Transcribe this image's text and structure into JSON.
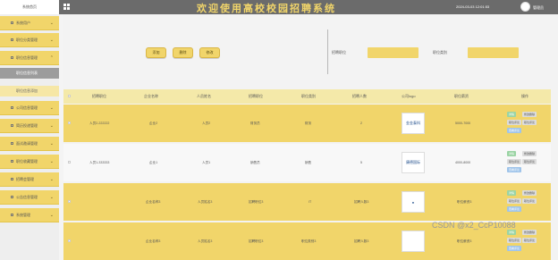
{
  "topbar": {
    "logo_text": "系统首页",
    "title": "欢迎使用高校校园招聘系统",
    "datetime": "2024-03-03 12:01:53",
    "username": "管理员"
  },
  "sidebar": {
    "items": [
      {
        "label": "系统用户"
      },
      {
        "label": "职位分类管理"
      },
      {
        "label": "职位信息管理"
      },
      {
        "label": "公司信息管理"
      },
      {
        "label": "简历投递管理"
      },
      {
        "label": "面试邀请管理"
      },
      {
        "label": "职位收藏管理"
      },
      {
        "label": "招聘会管理"
      },
      {
        "label": "公告信息管理"
      },
      {
        "label": "系统管理"
      }
    ],
    "sub_active": "职位信息列表",
    "sub_light": "职位信息添加"
  },
  "toolbar": {
    "add": "添加",
    "delete": "删除",
    "edit": "修改"
  },
  "filters": {
    "job_title_label": "招聘职位",
    "job_category_label": "职位类别",
    "job_category_placeholder": "职位类别"
  },
  "table": {
    "headers": [
      "招聘职位",
      "企业名称",
      "人员姓名",
      "招聘职位",
      "职位类别",
      "招聘人数",
      "公司logo",
      "职位薪资",
      "操作"
    ],
    "rows": [
      {
        "title": "人员2-222222",
        "company": "企业2",
        "person": "人员2",
        "position": "财务员",
        "category": "财务",
        "count": "2",
        "logo": "金金泰科",
        "salary": "5000-7000"
      },
      {
        "title": "人员1-333333",
        "company": "企业1",
        "person": "人员1",
        "position": "销售员",
        "category": "销售",
        "count": "5",
        "logo": "康德国际",
        "salary": "4000-8000"
      },
      {
        "title": "",
        "company": "企业名称3",
        "person": "人员姓名3",
        "position": "招聘职位3",
        "category": "IT",
        "count": "招聘人数3",
        "logo": "",
        "salary": "职位薪资3"
      },
      {
        "title": "",
        "company": "企业名称3",
        "person": "人员姓名3",
        "position": "招聘职位3",
        "category": "职位类别3",
        "count": "招聘人数3",
        "logo": "",
        "salary": "职位薪资3"
      }
    ],
    "actions": {
      "view": "详情",
      "edit": "修改删除",
      "apply": "职位评论",
      "review": "查看评论"
    }
  },
  "watermark": "CSDN @x2_CcP10088",
  "colors": {
    "accent": "#f1d56a",
    "topbar": "#6b6b6b",
    "header_row": "#f4e9a9"
  }
}
